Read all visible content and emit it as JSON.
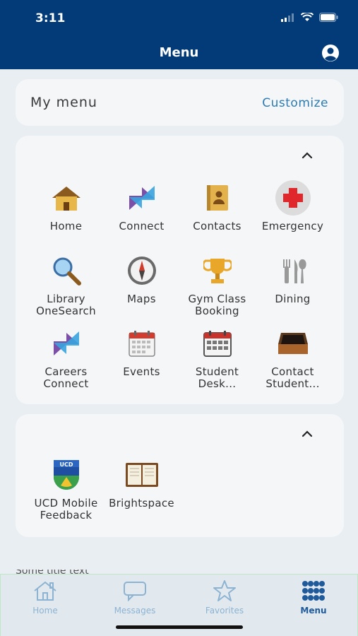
{
  "status_bar": {
    "time": "3:11"
  },
  "header": {
    "title": "Menu"
  },
  "my_menu": {
    "title": "My menu",
    "customize_label": "Customize"
  },
  "section_main": {
    "items": [
      {
        "label": "Home",
        "icon": "house-icon"
      },
      {
        "label": "Connect",
        "icon": "connect-arrows-icon"
      },
      {
        "label": "Contacts",
        "icon": "address-book-icon"
      },
      {
        "label": "Emergency",
        "icon": "red-cross-icon"
      },
      {
        "label": "Library OneSearch",
        "icon": "magnifier-icon"
      },
      {
        "label": "Maps",
        "icon": "compass-icon"
      },
      {
        "label": "Gym Class Booking",
        "icon": "trophy-icon"
      },
      {
        "label": "Dining",
        "icon": "cutlery-icon"
      },
      {
        "label": "Careers Connect",
        "icon": "connect-arrows-icon"
      },
      {
        "label": "Events",
        "icon": "calendar-icon"
      },
      {
        "label": "Student Desk...",
        "icon": "calendar-icon"
      },
      {
        "label": "Contact Student...",
        "icon": "inbox-tray-icon"
      }
    ]
  },
  "section_feedback": {
    "items": [
      {
        "label": "UCD Mobile Feedback",
        "icon": "ucd-crest-icon"
      },
      {
        "label": "Brightspace",
        "icon": "book-icon"
      }
    ]
  },
  "peek_text": "Some title text",
  "tabbar": {
    "tabs": [
      {
        "label": "Home",
        "icon": "home-icon",
        "active": false
      },
      {
        "label": "Messages",
        "icon": "chat-bubble-icon",
        "active": false
      },
      {
        "label": "Favorites",
        "icon": "star-icon",
        "active": false
      },
      {
        "label": "Menu",
        "icon": "grid-dots-icon",
        "active": true
      }
    ]
  },
  "colors": {
    "header_bg": "#023b78",
    "accent": "#2c7bb3",
    "active_tab": "#1f5a9a",
    "inactive_tab": "#8db3d2"
  }
}
